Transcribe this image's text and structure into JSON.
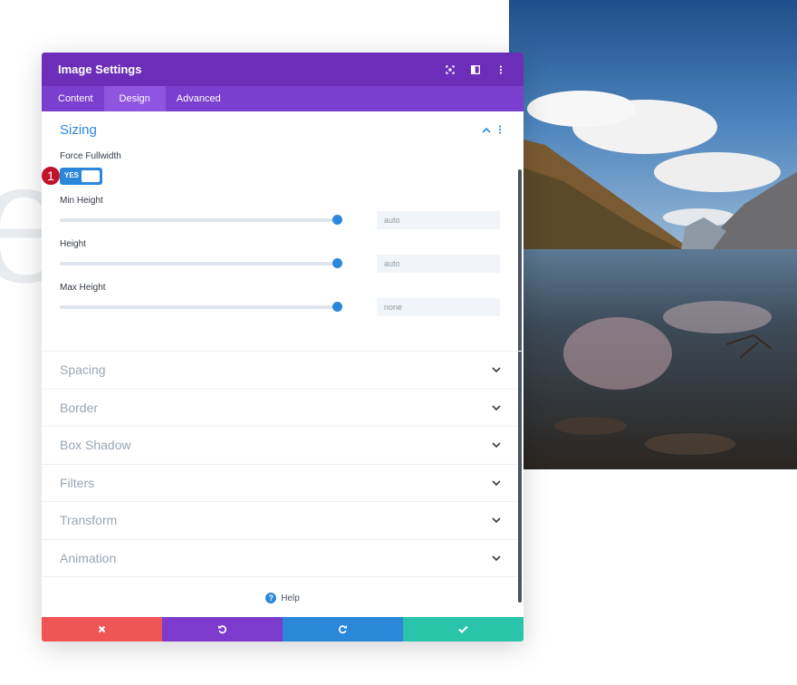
{
  "panel": {
    "title": "Image Settings",
    "header_icons": [
      "expand-icon",
      "split-view-icon",
      "more-options-icon"
    ]
  },
  "tabs": [
    {
      "label": "Content",
      "active": false
    },
    {
      "label": "Design",
      "active": true
    },
    {
      "label": "Advanced",
      "active": false
    }
  ],
  "sizing": {
    "title": "Sizing",
    "force_fullwidth_label": "Force Fullwidth",
    "toggle_value": "YES",
    "badge": "1",
    "min_height": {
      "label": "Min Height",
      "value": "auto",
      "slider_fraction": 1.0
    },
    "height": {
      "label": "Height",
      "value": "auto",
      "slider_fraction": 1.0
    },
    "max_height": {
      "label": "Max Height",
      "value": "none",
      "slider_fraction": 1.0
    }
  },
  "sections": [
    "Spacing",
    "Border",
    "Box Shadow",
    "Filters",
    "Transform",
    "Animation"
  ],
  "help_label": "Help",
  "footer": {
    "icons": [
      "close-icon",
      "undo-icon",
      "redo-icon",
      "check-icon"
    ]
  },
  "colors": {
    "header": "#6c2eb9",
    "tabs": "#7b3fd0",
    "accent_blue": "#2b87da",
    "cancel": "#ef5555",
    "undo": "#7d3bce",
    "redo": "#2b87da",
    "save": "#29c4a9",
    "badge": "#c0142d"
  },
  "background_letter": "e"
}
